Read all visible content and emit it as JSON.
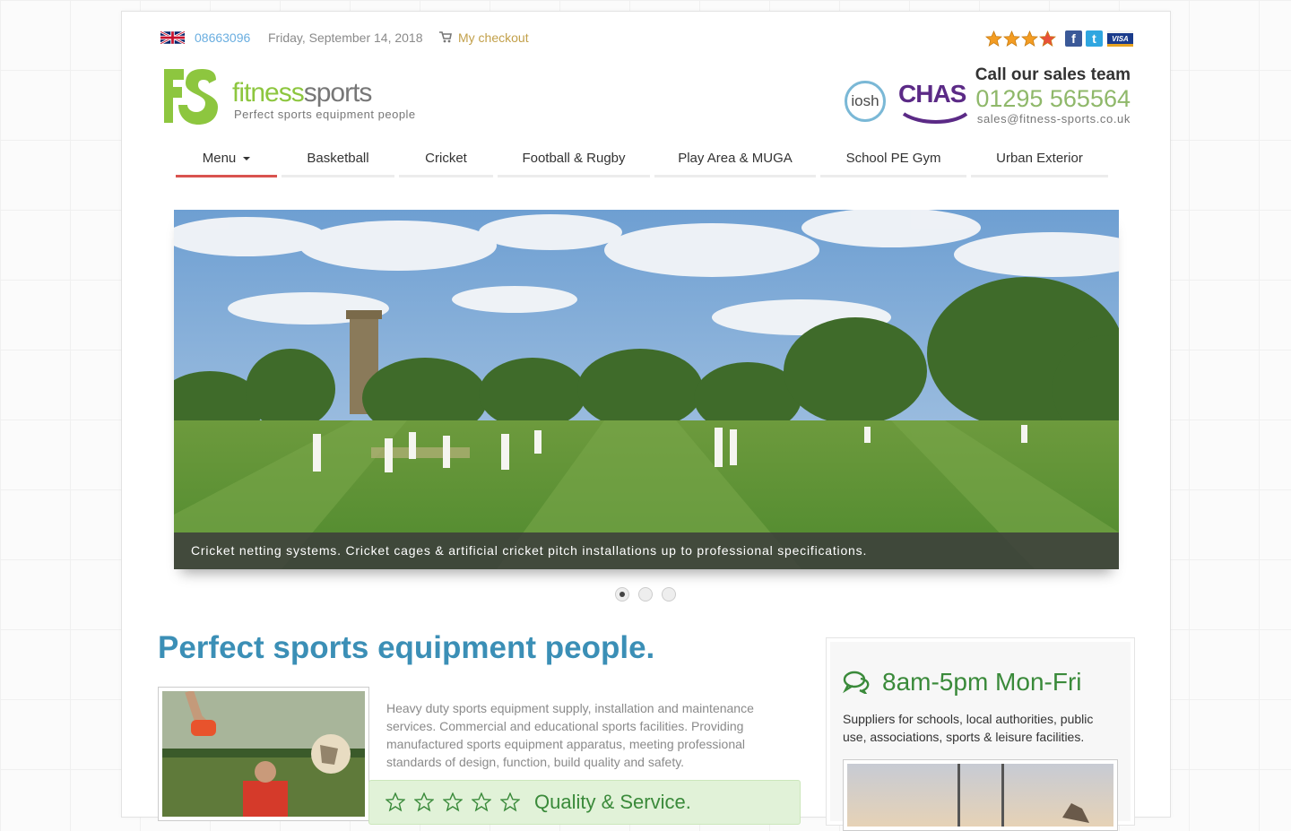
{
  "topbar": {
    "flag_icon": "uk-flag-icon",
    "phone": "08663096",
    "date": "Friday, September 14, 2018",
    "cart_icon": "shopping-cart-icon",
    "checkout": "My checkout",
    "rating_stars": 4,
    "social": {
      "facebook": "f",
      "twitter": "t"
    },
    "payment": "VISA"
  },
  "brand": {
    "name_light": "fitness",
    "name_dark": "sports",
    "tagline": "Perfect sports equipment people",
    "logo_letters": "FS"
  },
  "accreditations": {
    "iosh": "iosh",
    "chas": "CHAS"
  },
  "sales": {
    "title": "Call our sales team",
    "phone": "01295 565564",
    "email": "sales@fitness-sports.co.uk"
  },
  "nav": {
    "items": [
      {
        "label": "Menu"
      },
      {
        "label": "Basketball"
      },
      {
        "label": "Cricket"
      },
      {
        "label": "Football & Rugby"
      },
      {
        "label": "Play Area & MUGA"
      },
      {
        "label": "School PE Gym"
      },
      {
        "label": "Urban Exterior"
      }
    ]
  },
  "slider": {
    "caption": "Cricket netting systems. Cricket cages & artificial cricket pitch installations up to professional specifications.",
    "slide_count": 3,
    "active_slide": 1
  },
  "main": {
    "headline": "Perfect sports equipment people.",
    "intro": "Heavy duty sports equipment supply, installation and maintenance services. Commercial and educational sports facilities. Providing manufactured sports equipment apparatus, meeting professional standards of design, function, build quality and safety.",
    "quality_label": "Quality & Service.",
    "quality_stars": 5
  },
  "panel": {
    "chat_icon": "chat-bubbles-icon",
    "hours": "8am-5pm Mon-Fri",
    "suppliers": "Suppliers for schools, local authorities, public use, associations, sports & leisure facilities."
  },
  "colors": {
    "accent_green": "#8dc63f",
    "headline_blue": "#3b8fb6",
    "nav_active": "#d9534f",
    "quality_green": "#3a8a3a"
  }
}
